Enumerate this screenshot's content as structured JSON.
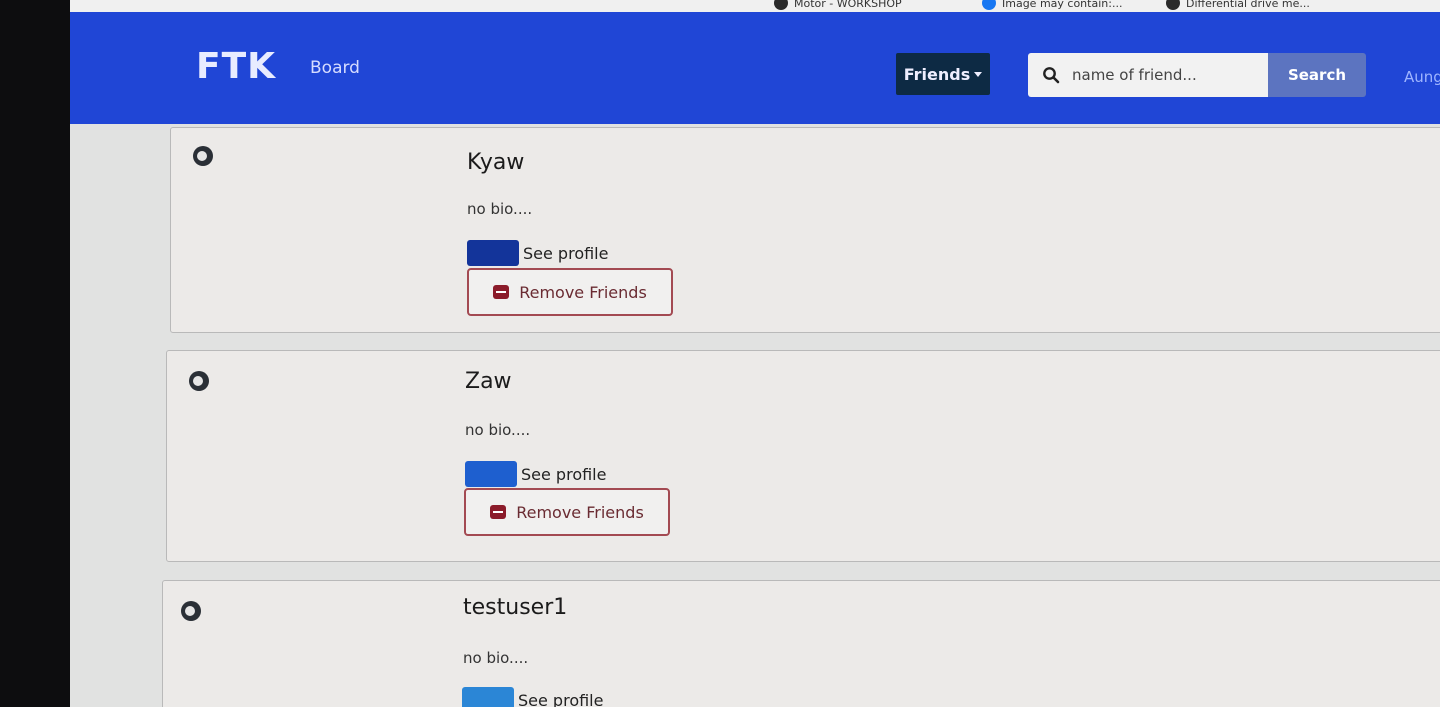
{
  "bookmarks": {
    "items": [
      {
        "label": "Motor - WORKSHOP",
        "icon": "wordpress-icon"
      },
      {
        "label": "Image may contain:...",
        "icon": "facebook-icon"
      },
      {
        "label": "Differential drive me...",
        "icon": "globe-icon"
      }
    ]
  },
  "navbar": {
    "brand": "FTK",
    "board_label": "Board",
    "friends_label": "Friends",
    "search_placeholder": "name of friend...",
    "search_button": "Search",
    "user_label": "Aung"
  },
  "friends": [
    {
      "name": "Kyaw",
      "bio": "no bio....",
      "see_profile": "See profile",
      "remove_label": "Remove Friends",
      "swatch_color": "#13349a"
    },
    {
      "name": "Zaw",
      "bio": "no bio....",
      "see_profile": "See profile",
      "remove_label": "Remove Friends",
      "swatch_color": "#1e5fcf"
    },
    {
      "name": "testuser1",
      "bio": "no bio....",
      "see_profile": "See profile",
      "swatch_color": "#2b86d6"
    }
  ],
  "colors": {
    "navbar": "#2046d6",
    "friends_dropdown": "#0d2a44",
    "remove_border": "#a34a52"
  }
}
